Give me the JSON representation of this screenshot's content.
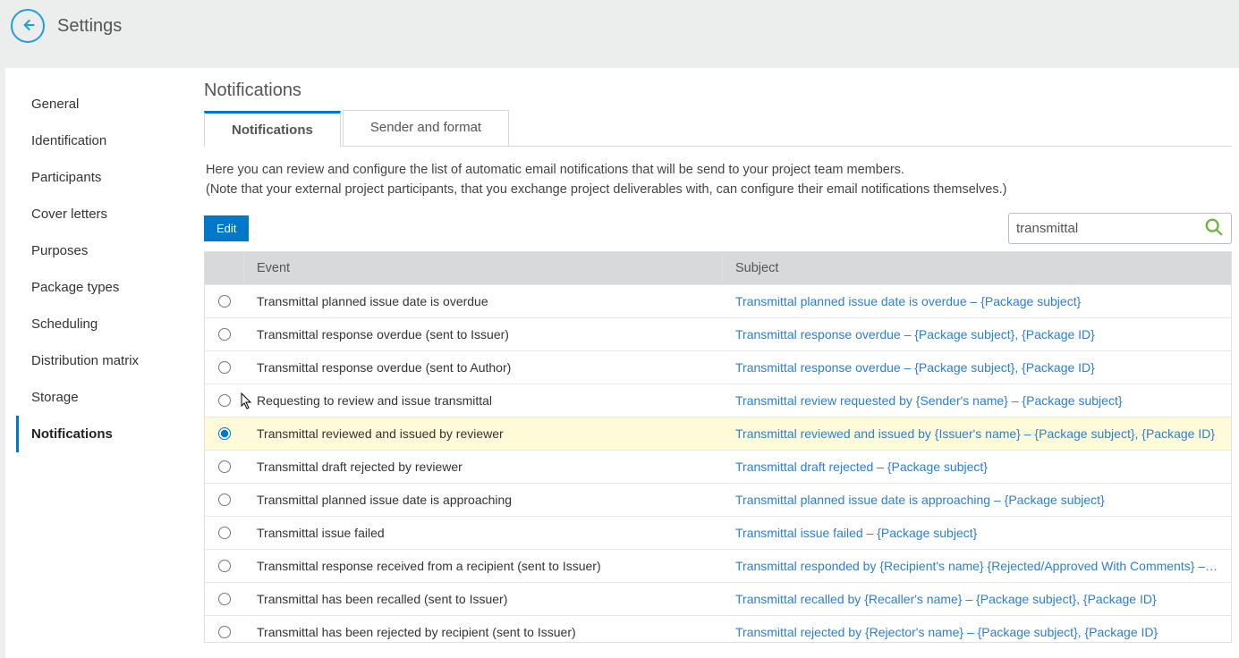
{
  "header": {
    "title": "Settings"
  },
  "sidebar": {
    "items": [
      {
        "label": "General"
      },
      {
        "label": "Identification"
      },
      {
        "label": "Participants"
      },
      {
        "label": "Cover letters"
      },
      {
        "label": "Purposes"
      },
      {
        "label": "Package types"
      },
      {
        "label": "Scheduling"
      },
      {
        "label": "Distribution matrix"
      },
      {
        "label": "Storage"
      },
      {
        "label": "Notifications"
      }
    ],
    "activeIndex": 9
  },
  "page": {
    "title": "Notifications",
    "tabs": [
      {
        "label": "Notifications"
      },
      {
        "label": "Sender and format"
      }
    ],
    "activeTab": 0,
    "desc_line1": "Here you can review and configure the list of automatic email notifications that will be send to your project team members.",
    "desc_line2": "(Note that your external project participants, that you exchange project deliverables with, can configure their email notifications themselves.)"
  },
  "toolbar": {
    "edit_label": "Edit",
    "search_value": "transmittal"
  },
  "table": {
    "headers": {
      "event": "Event",
      "subject": "Subject"
    },
    "selectedIndex": 4,
    "rows": [
      {
        "event": "Transmittal planned issue date is overdue",
        "subject": "Transmittal planned issue date is overdue – {Package subject}"
      },
      {
        "event": "Transmittal response overdue (sent to Issuer)",
        "subject": "Transmittal response overdue – {Package subject}, {Package ID}"
      },
      {
        "event": "Transmittal response overdue (sent to Author)",
        "subject": "Transmittal response overdue – {Package subject}, {Package ID}"
      },
      {
        "event": "Requesting to review and issue transmittal",
        "subject": "Transmittal review requested by {Sender's name} – {Package subject}"
      },
      {
        "event": "Transmittal reviewed and issued by reviewer",
        "subject": "Transmittal reviewed and issued by {Issuer's name} – {Package subject}, {Package ID}"
      },
      {
        "event": "Transmittal draft rejected by reviewer",
        "subject": "Transmittal draft rejected – {Package subject}"
      },
      {
        "event": "Transmittal planned issue date is approaching",
        "subject": "Transmittal planned issue date is approaching – {Package subject}"
      },
      {
        "event": "Transmittal issue failed",
        "subject": "Transmittal issue failed – {Package subject}"
      },
      {
        "event": "Transmittal response received from a recipient (sent to Issuer)",
        "subject": "Transmittal responded by {Recipient's name} {Rejected/Approved With Comments} – {Package subject}"
      },
      {
        "event": "Transmittal has been recalled (sent to Issuer)",
        "subject": "Transmittal recalled by {Recaller's name} – {Package subject}, {Package ID}"
      },
      {
        "event": "Transmittal has been rejected by recipient (sent to Issuer)",
        "subject": "Transmittal rejected by {Rejector's name} – {Package subject}, {Package ID}"
      }
    ]
  }
}
